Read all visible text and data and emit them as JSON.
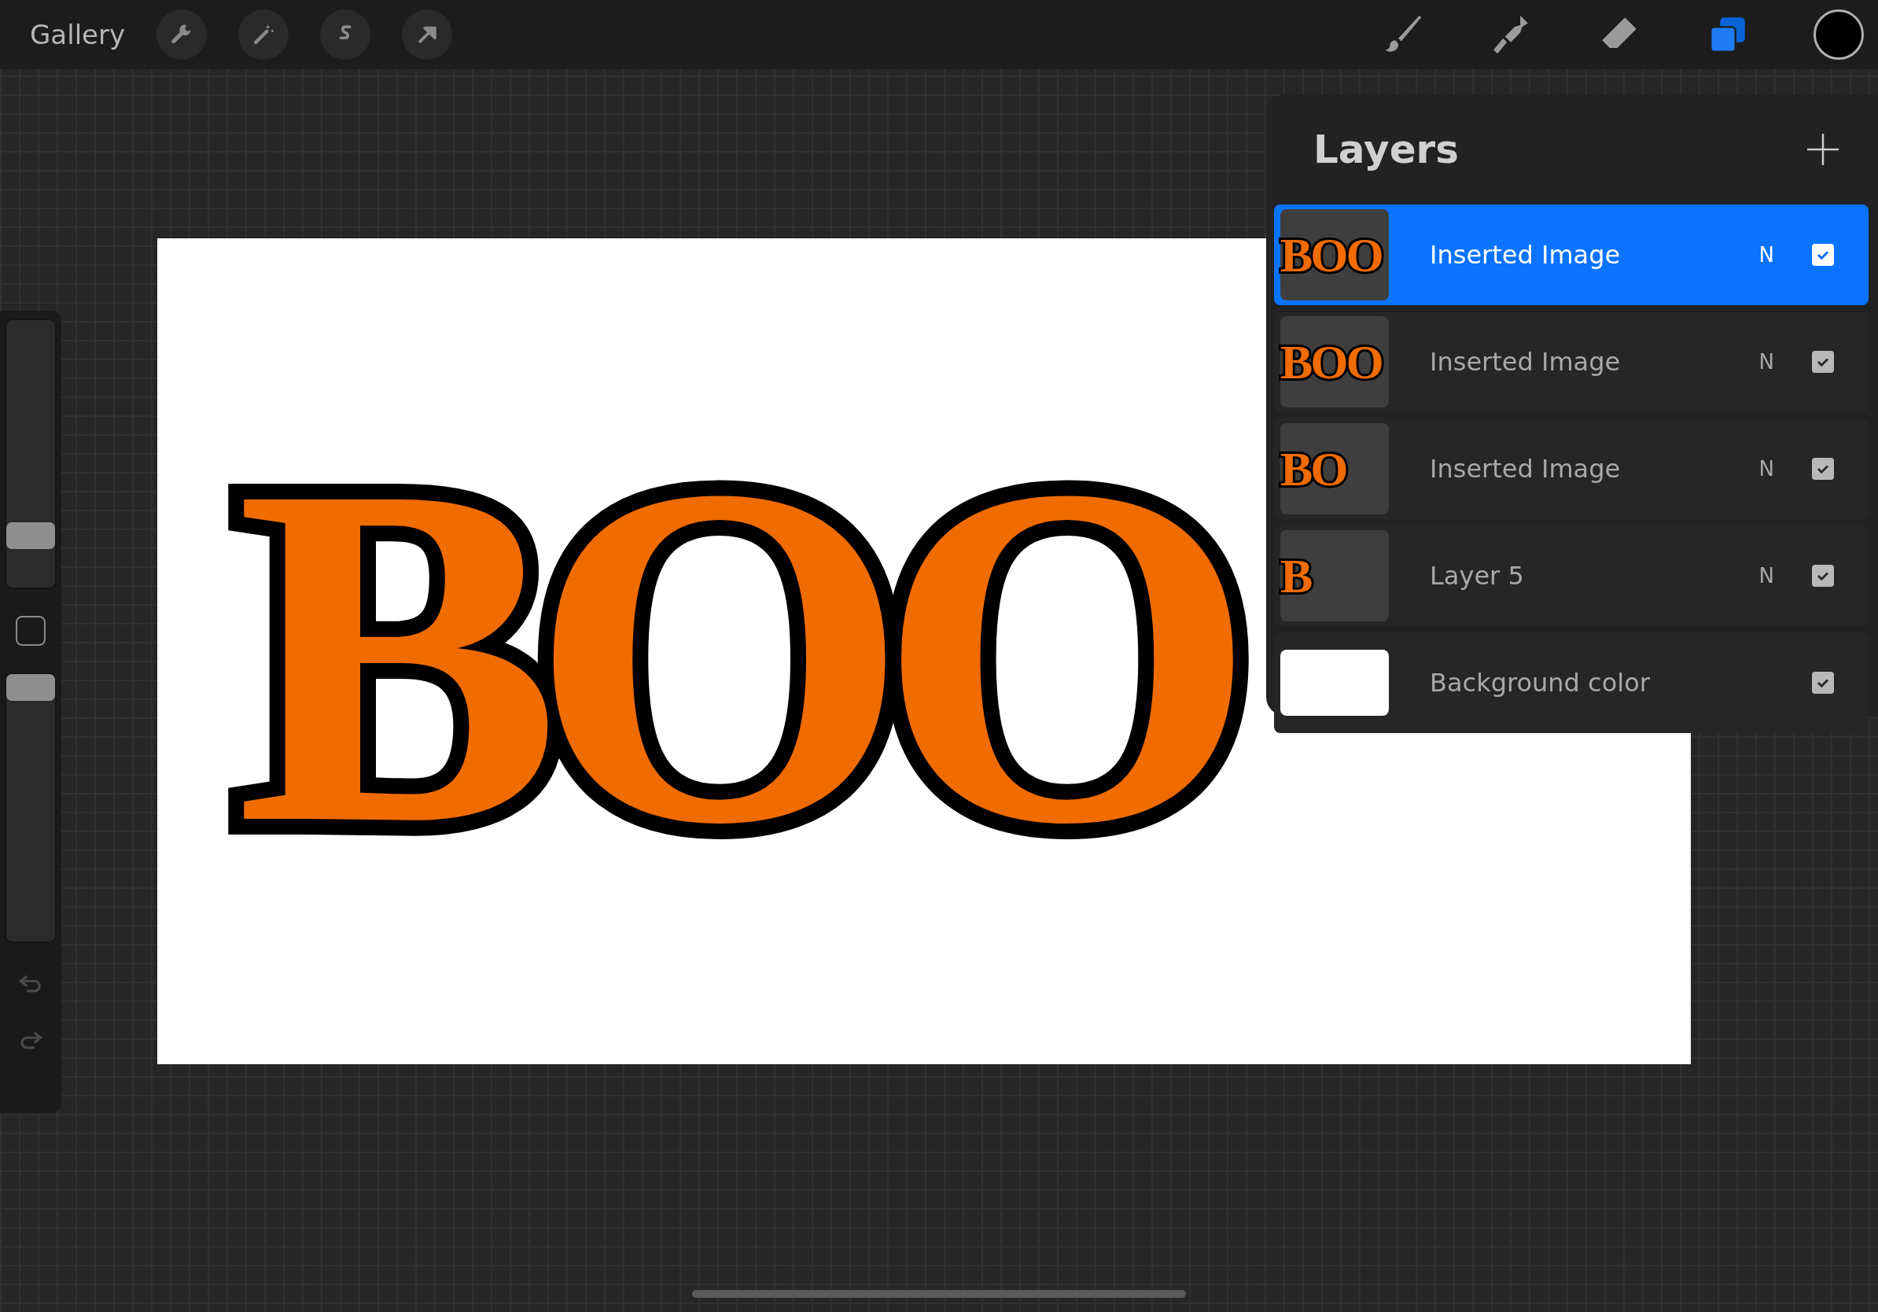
{
  "toolbar": {
    "gallery": "Gallery"
  },
  "sidebar": {
    "brush_size": {
      "level": 0.16
    },
    "opacity": {
      "level": 1.0
    }
  },
  "canvas": {
    "artwork_text": "BOO"
  },
  "layers_panel": {
    "title": "Layers",
    "layers": [
      {
        "name": "Inserted Image",
        "thumb_text": "BOO",
        "blend": "N",
        "visible": true,
        "selected": true
      },
      {
        "name": "Inserted Image",
        "thumb_text": "BOO",
        "blend": "N",
        "visible": true,
        "selected": false
      },
      {
        "name": "Inserted Image",
        "thumb_text": "BO",
        "blend": "N",
        "visible": true,
        "selected": false
      },
      {
        "name": "Layer 5",
        "thumb_text": "B",
        "blend": "N",
        "visible": true,
        "selected": false
      },
      {
        "name": "Background color",
        "visible": true,
        "selected": false
      }
    ]
  }
}
